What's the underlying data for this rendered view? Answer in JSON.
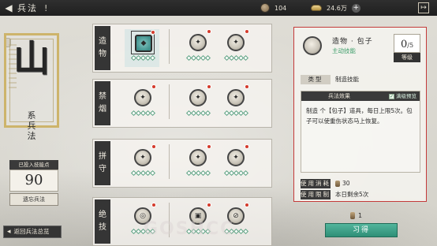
{
  "header": {
    "back_icon": "chevron-left",
    "title": "兵法",
    "info_icon": "!",
    "hourglass_value": "104",
    "ingot_value": "24.6万",
    "plus_label": "+",
    "exit_icon": "exit"
  },
  "school": {
    "seal_char": "山",
    "label": "系兵法"
  },
  "points": {
    "title": "已投入技能点",
    "value": "90",
    "reselect_label": "遗忘兵法"
  },
  "return_label": "返回兵法总览",
  "rows": [
    {
      "label": "造物",
      "slots": [
        {
          "glyph": "◆",
          "selected": true,
          "dot": true,
          "style": "teal",
          "ranks": 5
        },
        {
          "glyph": "✦",
          "selected": false,
          "dot": true,
          "style": "normal",
          "ranks": 5
        },
        {
          "glyph": "✦",
          "selected": false,
          "dot": true,
          "style": "normal",
          "ranks": 5
        }
      ]
    },
    {
      "label": "禁烟",
      "slots": [
        {
          "glyph": "✦",
          "selected": false,
          "dot": true,
          "style": "normal",
          "ranks": 5
        },
        {
          "glyph": "✦",
          "selected": false,
          "dot": true,
          "style": "normal",
          "ranks": 5
        },
        {
          "glyph": "✦",
          "selected": false,
          "dot": true,
          "style": "normal",
          "ranks": 5
        }
      ]
    },
    {
      "label": "拼守",
      "slots": [
        {
          "glyph": "✦",
          "selected": false,
          "dot": true,
          "style": "normal",
          "ranks": 5
        },
        {
          "glyph": "✦",
          "selected": false,
          "dot": true,
          "style": "normal",
          "ranks": 5
        },
        {
          "glyph": "✦",
          "selected": false,
          "dot": true,
          "style": "normal",
          "ranks": 5
        }
      ]
    },
    {
      "label": "绝技",
      "slots": [
        {
          "glyph": "◎",
          "selected": false,
          "dot": true,
          "style": "normal",
          "ranks": 5
        },
        {
          "glyph": "▣",
          "selected": false,
          "dot": true,
          "style": "normal",
          "ranks": 5
        },
        {
          "glyph": "⊘",
          "selected": false,
          "dot": true,
          "style": "normal",
          "ranks": 5
        }
      ]
    }
  ],
  "detail": {
    "name": "造物 · 包子",
    "skill_type": "主动技能",
    "level_current": "0",
    "level_max": "5",
    "level_caption": "等级",
    "category_key": "类型",
    "category_val": "制造技能",
    "effect_title": "兵法效果",
    "preview_label": "满级预览",
    "effect_text": "制造 个【包子】道具，每日上限5次。包子可以使重伤状态马上恢复。",
    "cost_key": "使用消耗",
    "cost_val": "30",
    "limit_key": "使用限制",
    "limit_val": "本日剩余5次"
  },
  "bottom": {
    "count": "1",
    "learn_label": "习得",
    "watermark": "GOSHCC"
  }
}
